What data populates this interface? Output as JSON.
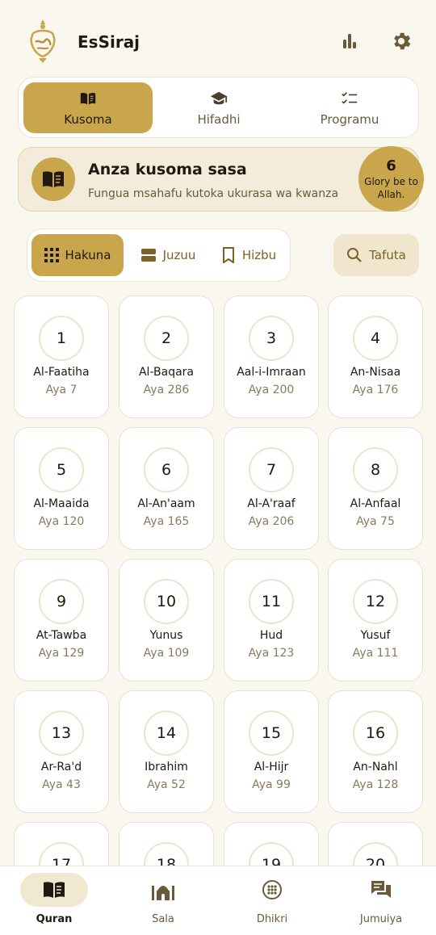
{
  "header": {
    "app_name": "EsSiraj",
    "logo_icon": "essiraj-lamp-logo",
    "stats_icon": "bar-chart-icon",
    "settings_icon": "gear-icon"
  },
  "segments": [
    {
      "label": "Kusoma",
      "icon": "open-book-icon",
      "active": true
    },
    {
      "label": "Hifadhi",
      "icon": "graduation-cap-icon",
      "active": false
    },
    {
      "label": "Programu",
      "icon": "checklist-icon",
      "active": false
    }
  ],
  "banner": {
    "title": "Anza kusoma sasa",
    "subtitle": "Fungua msahafu kutoka ukurasa wa kwanza",
    "badge_count": "6",
    "badge_text": "Glory be to Allah."
  },
  "view_filter": [
    {
      "label": "Hakuna",
      "icon": "grid-icon",
      "active": true
    },
    {
      "label": "Juzuu",
      "icon": "layers-icon",
      "active": false
    },
    {
      "label": "Hizbu",
      "icon": "bookmark-icon",
      "active": false
    }
  ],
  "search": {
    "label": "Tafuta",
    "icon": "search-icon"
  },
  "surahs": [
    {
      "number": "1",
      "name": "Al-Faatiha",
      "ayah": "Aya 7"
    },
    {
      "number": "2",
      "name": "Al-Baqara",
      "ayah": "Aya 286"
    },
    {
      "number": "3",
      "name": "Aal-i-Imraan",
      "ayah": "Aya 200"
    },
    {
      "number": "4",
      "name": "An-Nisaa",
      "ayah": "Aya 176"
    },
    {
      "number": "5",
      "name": "Al-Maaida",
      "ayah": "Aya 120"
    },
    {
      "number": "6",
      "name": "Al-An'aam",
      "ayah": "Aya 165"
    },
    {
      "number": "7",
      "name": "Al-A'raaf",
      "ayah": "Aya 206"
    },
    {
      "number": "8",
      "name": "Al-Anfaal",
      "ayah": "Aya 75"
    },
    {
      "number": "9",
      "name": "At-Tawba",
      "ayah": "Aya 129"
    },
    {
      "number": "10",
      "name": "Yunus",
      "ayah": "Aya 109"
    },
    {
      "number": "11",
      "name": "Hud",
      "ayah": "Aya 123"
    },
    {
      "number": "12",
      "name": "Yusuf",
      "ayah": "Aya 111"
    },
    {
      "number": "13",
      "name": "Ar-Ra'd",
      "ayah": "Aya 43"
    },
    {
      "number": "14",
      "name": "Ibrahim",
      "ayah": "Aya 52"
    },
    {
      "number": "15",
      "name": "Al-Hijr",
      "ayah": "Aya 99"
    },
    {
      "number": "16",
      "name": "An-Nahl",
      "ayah": "Aya 128"
    },
    {
      "number": "17",
      "name": "",
      "ayah": ""
    },
    {
      "number": "18",
      "name": "",
      "ayah": ""
    },
    {
      "number": "19",
      "name": "",
      "ayah": ""
    },
    {
      "number": "20",
      "name": "",
      "ayah": ""
    }
  ],
  "bottom_nav": [
    {
      "label": "Quran",
      "icon": "quran-book-icon",
      "active": true
    },
    {
      "label": "Sala",
      "icon": "mosque-icon",
      "active": false
    },
    {
      "label": "Dhikri",
      "icon": "tasbih-icon",
      "active": false
    },
    {
      "label": "Jumuiya",
      "icon": "chat-bubbles-icon",
      "active": false
    }
  ],
  "colors": {
    "accent": "#c9a64b",
    "background": "#faf7ef",
    "banner_bg": "#f3ecdb",
    "text_dark": "#1f1a10",
    "text_muted": "#8a7a5c"
  }
}
